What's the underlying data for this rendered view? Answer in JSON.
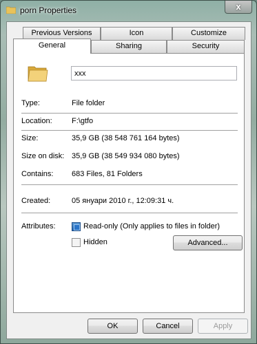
{
  "window": {
    "title": "porn Properties",
    "close_glyph": "x"
  },
  "tabs_row1": [
    "Previous Versions",
    "Icon",
    "Customize"
  ],
  "tabs_row2": [
    "General",
    "Sharing",
    "Security"
  ],
  "general": {
    "name_value": "xxx",
    "type_label": "Type:",
    "type_value": "File folder",
    "location_label": "Location:",
    "location_value": "F:\\gtfo",
    "size_label": "Size:",
    "size_value": "35,9 GB (38 548 761 164 bytes)",
    "size_on_disk_label": "Size on disk:",
    "size_on_disk_value": "35,9 GB (38 549 934 080 bytes)",
    "contains_label": "Contains:",
    "contains_value": "683 Files, 81 Folders",
    "created_label": "Created:",
    "created_value": "05 януари 2010 г., 12:09:31 ч.",
    "attributes_label": "Attributes:",
    "readonly_label": "Read-only (Only applies to files in folder)",
    "readonly_checked": true,
    "hidden_label": "Hidden",
    "hidden_checked": false,
    "advanced_label": "Advanced..."
  },
  "buttons": {
    "ok": "OK",
    "cancel": "Cancel",
    "apply": "Apply"
  },
  "icons": {
    "title": "folder-icon",
    "general": "folder-icon"
  }
}
